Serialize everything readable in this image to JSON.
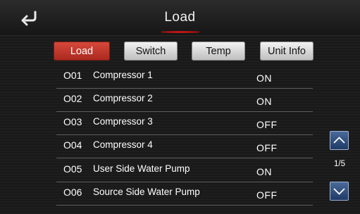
{
  "header": {
    "title": "Load"
  },
  "tabs": [
    {
      "label": "Load",
      "active": true
    },
    {
      "label": "Switch",
      "active": false
    },
    {
      "label": "Temp",
      "active": false
    },
    {
      "label": "Unit Info",
      "active": false
    }
  ],
  "items": [
    {
      "code": "O01",
      "name": "Compressor 1",
      "status": "ON"
    },
    {
      "code": "O02",
      "name": "Compressor 2",
      "status": "ON"
    },
    {
      "code": "O03",
      "name": "Compressor 3",
      "status": "OFF"
    },
    {
      "code": "O04",
      "name": "Compressor 4",
      "status": "OFF"
    },
    {
      "code": "O05",
      "name": "User Side Water Pump",
      "status": "ON"
    },
    {
      "code": "O06",
      "name": "Source Side Water Pump",
      "status": "OFF"
    }
  ],
  "pagination": {
    "indicator": "1/5"
  },
  "icons": {
    "back": "back-arrow-icon",
    "up": "chevron-up-icon",
    "down": "chevron-down-icon"
  },
  "colors": {
    "active_tab": "#c0392b",
    "nav_button": "#2d4a78",
    "title_accent": "#d01818"
  }
}
